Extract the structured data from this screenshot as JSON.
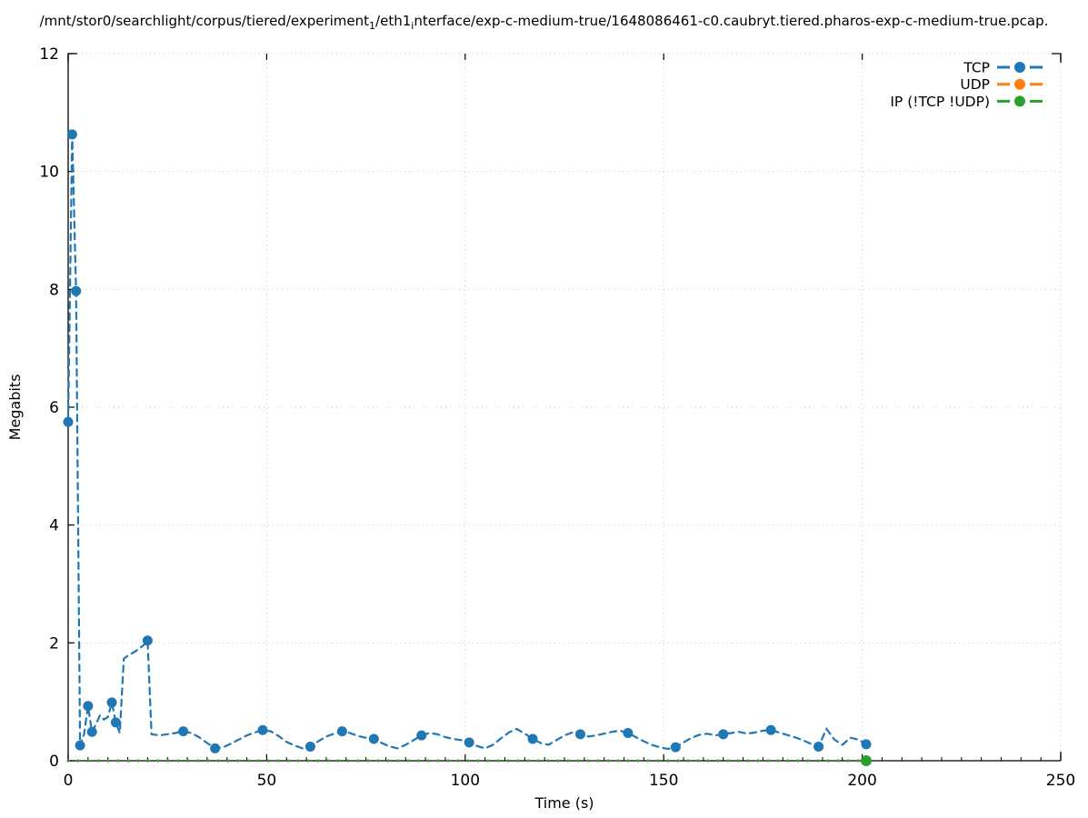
{
  "title": {
    "part1": "/mnt/stor0/searchlight/corpus/tiered/experiment",
    "sub1": "1",
    "part2": "/eth1",
    "sub2": "i",
    "part3": "nterface/exp-c-medium-true/1648086461-c0.caubryt.tiered.pharos-exp-c-medium-true.pcap."
  },
  "colors": {
    "tcp": "#1f77b4",
    "udp": "#ff7f0e",
    "ip_other": "#2ca02c",
    "grid": "#c8c8c8",
    "axis": "#000000",
    "background": "#ffffff"
  },
  "chart_data": {
    "type": "line",
    "title": "/mnt/stor0/searchlight/corpus/tiered/experiment_1/eth1_interface/exp-c-medium-true/1648086461-c0.caubryt.tiered.pharos-exp-c-medium-true.pcap.",
    "xlabel": "Time (s)",
    "ylabel": "Megabits",
    "xlim": [
      0,
      250
    ],
    "ylim": [
      0,
      12
    ],
    "x_ticks": [
      0,
      50,
      100,
      150,
      200,
      250
    ],
    "y_ticks": [
      0,
      2,
      4,
      6,
      8,
      10,
      12
    ],
    "x_minor_tick_step": 5,
    "grid": true,
    "legend_position": "top-right",
    "series": [
      {
        "name": "TCP",
        "color": "#1f77b4",
        "style": "dashed-line-with-round-markers",
        "points": [
          [
            0,
            5.75
          ],
          [
            1,
            10.63
          ],
          [
            2,
            7.97
          ],
          [
            3,
            0.26
          ],
          [
            4,
            0.45
          ],
          [
            5,
            0.93
          ],
          [
            6,
            0.49
          ],
          [
            7,
            0.62
          ],
          [
            8,
            0.77
          ],
          [
            9,
            0.7
          ],
          [
            10,
            0.74
          ],
          [
            11,
            0.99
          ],
          [
            12,
            0.65
          ],
          [
            13,
            0.47
          ],
          [
            14,
            1.73
          ],
          [
            15,
            1.78
          ],
          [
            16,
            1.82
          ],
          [
            17,
            1.86
          ],
          [
            18,
            1.91
          ],
          [
            19,
            1.96
          ],
          [
            20,
            2.04
          ],
          [
            21,
            0.45
          ],
          [
            23,
            0.43
          ],
          [
            25,
            0.45
          ],
          [
            27,
            0.47
          ],
          [
            29,
            0.5
          ],
          [
            31,
            0.47
          ],
          [
            33,
            0.4
          ],
          [
            35,
            0.3
          ],
          [
            37,
            0.21
          ],
          [
            39,
            0.23
          ],
          [
            41,
            0.29
          ],
          [
            43,
            0.36
          ],
          [
            45,
            0.43
          ],
          [
            47,
            0.48
          ],
          [
            49,
            0.52
          ],
          [
            51,
            0.5
          ],
          [
            53,
            0.42
          ],
          [
            55,
            0.32
          ],
          [
            57,
            0.26
          ],
          [
            59,
            0.21
          ],
          [
            61,
            0.24
          ],
          [
            63,
            0.33
          ],
          [
            65,
            0.41
          ],
          [
            67,
            0.46
          ],
          [
            69,
            0.5
          ],
          [
            71,
            0.47
          ],
          [
            73,
            0.42
          ],
          [
            75,
            0.39
          ],
          [
            77,
            0.37
          ],
          [
            79,
            0.3
          ],
          [
            81,
            0.24
          ],
          [
            83,
            0.21
          ],
          [
            85,
            0.27
          ],
          [
            87,
            0.35
          ],
          [
            89,
            0.43
          ],
          [
            91,
            0.47
          ],
          [
            93,
            0.45
          ],
          [
            95,
            0.4
          ],
          [
            97,
            0.37
          ],
          [
            99,
            0.35
          ],
          [
            101,
            0.31
          ],
          [
            103,
            0.25
          ],
          [
            105,
            0.21
          ],
          [
            107,
            0.27
          ],
          [
            109,
            0.38
          ],
          [
            111,
            0.48
          ],
          [
            113,
            0.54
          ],
          [
            115,
            0.46
          ],
          [
            117,
            0.37
          ],
          [
            119,
            0.3
          ],
          [
            121,
            0.27
          ],
          [
            123,
            0.35
          ],
          [
            125,
            0.43
          ],
          [
            127,
            0.48
          ],
          [
            129,
            0.45
          ],
          [
            131,
            0.41
          ],
          [
            133,
            0.43
          ],
          [
            135,
            0.46
          ],
          [
            137,
            0.49
          ],
          [
            139,
            0.51
          ],
          [
            141,
            0.47
          ],
          [
            143,
            0.4
          ],
          [
            145,
            0.33
          ],
          [
            147,
            0.27
          ],
          [
            149,
            0.23
          ],
          [
            151,
            0.2
          ],
          [
            153,
            0.23
          ],
          [
            155,
            0.31
          ],
          [
            157,
            0.39
          ],
          [
            159,
            0.44
          ],
          [
            161,
            0.46
          ],
          [
            163,
            0.43
          ],
          [
            165,
            0.45
          ],
          [
            167,
            0.47
          ],
          [
            169,
            0.49
          ],
          [
            171,
            0.46
          ],
          [
            173,
            0.48
          ],
          [
            175,
            0.51
          ],
          [
            177,
            0.52
          ],
          [
            179,
            0.48
          ],
          [
            181,
            0.44
          ],
          [
            183,
            0.4
          ],
          [
            185,
            0.35
          ],
          [
            187,
            0.29
          ],
          [
            189,
            0.24
          ],
          [
            191,
            0.54
          ],
          [
            193,
            0.36
          ],
          [
            195,
            0.27
          ],
          [
            197,
            0.39
          ],
          [
            199,
            0.36
          ],
          [
            201,
            0.28
          ]
        ],
        "marker_times": [
          0,
          1,
          2,
          3,
          5,
          6,
          11,
          12,
          20,
          29,
          37,
          49,
          61,
          69,
          77,
          89,
          101,
          117,
          129,
          141,
          153,
          165,
          177,
          189,
          201
        ]
      },
      {
        "name": "UDP",
        "color": "#ff7f0e",
        "style": "dotted-line",
        "constant_value": 0,
        "points": [
          [
            0,
            0
          ],
          [
            201,
            0
          ]
        ]
      },
      {
        "name": "IP (!TCP  !UDP)",
        "color": "#2ca02c",
        "style": "dotted-line-with-end-marker",
        "constant_value": 0,
        "points": [
          [
            0,
            0
          ],
          [
            201,
            0
          ]
        ],
        "end_marker_t": 201
      }
    ]
  }
}
